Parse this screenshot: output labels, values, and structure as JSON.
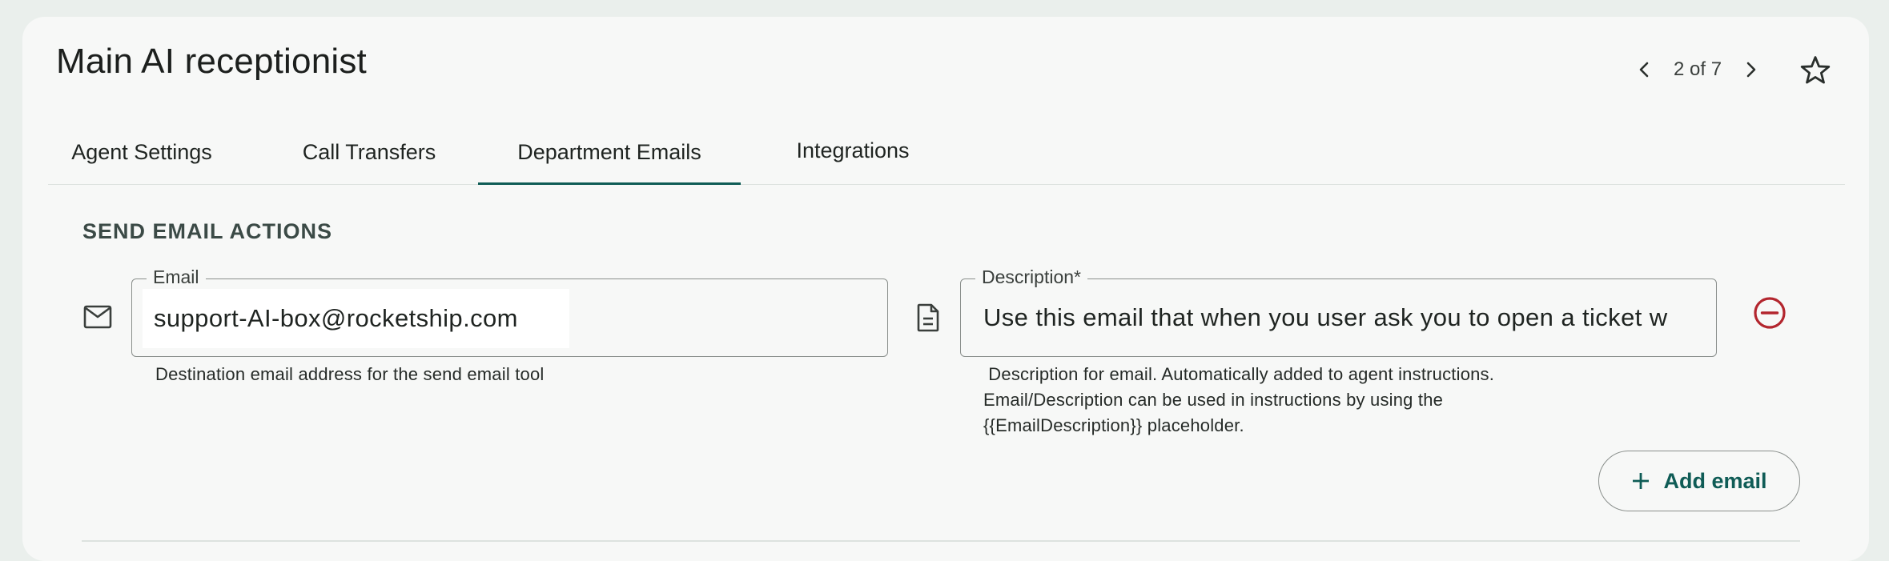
{
  "header": {
    "title": "Main AI receptionist",
    "pager_text": "2 of 7",
    "icons": [
      "chevron-left-icon",
      "chevron-right-icon",
      "star-outline-icon"
    ]
  },
  "tabs": [
    {
      "label": "Agent Settings",
      "active": false
    },
    {
      "label": "Call Transfers",
      "active": false
    },
    {
      "label": "Department Emails",
      "active": true
    },
    {
      "label": "Integrations",
      "active": false
    }
  ],
  "section": {
    "title": "SEND EMAIL ACTIONS"
  },
  "email_action": {
    "email": {
      "label": "Email",
      "value": "support-AI-box@rocketship.com",
      "helper": "Destination email address for the send email tool",
      "icon": "mail-icon"
    },
    "description": {
      "label": "Description*",
      "value": "Use this email that when you user ask you to open a ticket w",
      "helper_lines": [
        " Description for email. Automatically added to agent instructions.",
        "Email/Description can be used in instructions by using the",
        "{{EmailDescription}} placeholder."
      ],
      "icon": "document-icon"
    },
    "remove_icon": "remove-circle-icon"
  },
  "add_button": {
    "label": "Add email",
    "icon": "plus-icon"
  },
  "colors": {
    "accent": "#0f5c56",
    "danger": "#b3262e",
    "background": "#f7f8f7"
  }
}
